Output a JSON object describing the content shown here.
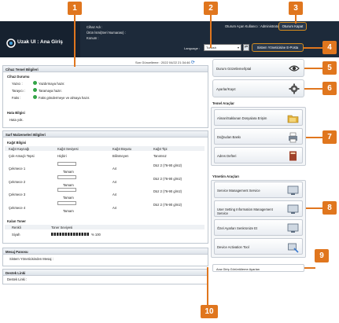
{
  "header": {
    "app_title": "Uzak UI : Ana Giriş",
    "device_name_label": "Cihaz Adı :",
    "product_name_label": "Ürün İsmi(Seri Numarası) :",
    "location_label": "Konum :",
    "login_user_label": "Oturum Açan Kullanıcı :",
    "login_user_value": "Administrator",
    "logout_label": "Oturum Kapat",
    "language_label": "Language :",
    "language_value": "Turkish",
    "admin_mail_label": "Sistem Yöneticisine E-Posta",
    "updated_label": "Son Güncelleme : 2022 04/22 21:34:46"
  },
  "device_info": {
    "title": "Cihaz Temel Bilgileri",
    "status_title": "Cihaz Durumu",
    "status_rows": [
      {
        "name": "Yazıcı :",
        "value": "Yazdırmaya hazır."
      },
      {
        "name": "Tarayıcı :",
        "value": "Taramaya hazır."
      },
      {
        "name": "Faks :",
        "value": "Faks göndermeye ve almaya hazır."
      }
    ],
    "error_title": "Hata Bilgisi",
    "error_value": "Hata yok."
  },
  "consumables": {
    "title": "Sarf Malzemeleri Bilgileri",
    "paper_title": "Kağıt Bilgisi",
    "columns": [
      "Kağıt Kaynağı",
      "Kağıt Seviyesi",
      "Kağıt Boyutu",
      "Kağıt Tipi"
    ],
    "rows": [
      {
        "source": "Çok-Amaçlı Tepsi",
        "level": "Hiçbiri",
        "size": "Bilinmeyen",
        "type": "Tanımsız"
      },
      {
        "source": "Çekmece 1",
        "level": "Tamam",
        "size": "A4",
        "type": "Düz 2 (76-90 g/m2)"
      },
      {
        "source": "Çekmece 2",
        "level": "Tamam",
        "size": "A4",
        "type": "Düz 2 (76-90 g/m2)"
      },
      {
        "source": "Çekmece 3",
        "level": "Tamam",
        "size": "A4",
        "type": "Düz 2 (76-90 g/m2)"
      },
      {
        "source": "Çekmece 4",
        "level": "Tamam",
        "size": "A4",
        "type": "Düz 2 (76-90 g/m2)"
      }
    ],
    "toner_title": "Kalan Toner",
    "toner_columns": [
      "Renkli",
      "Toner Seviyesi"
    ],
    "toner_name": "Siyah",
    "toner_level": "% 100",
    "toner_fraction": 1.0
  },
  "message_board": {
    "title": "Mesaj Panosu",
    "text": "Sistem Yöneticisinden Mesaj :"
  },
  "support": {
    "title": "Destek Linki",
    "text": "Destek Linki :"
  },
  "side": {
    "status_btn": "Durum Gözetleme/İptal",
    "settings_btn": "Ayarlar/Kayıt",
    "basic_title": "Temel Araçlar",
    "basic_items": [
      "Alınan/Saklanan Dosyalara Erişim",
      "Doğrudan Baskı",
      "Adres Defteri"
    ],
    "mgmt_title": "Yönetim Araçları",
    "mgmt_items": [
      "Service Management Service",
      "User Setting Information Management Service",
      "Özel Ayarları Senkronize Et",
      "Device Activation Tool"
    ],
    "portal_link": "Ana Giriş Görüntüleme Ayarları"
  },
  "callouts": [
    "1",
    "2",
    "3",
    "4",
    "5",
    "6",
    "7",
    "8",
    "9",
    "10"
  ],
  "colors": {
    "accent": "#e0761e",
    "header_bg": "#1d2a3a",
    "ok_green": "#33a447"
  }
}
